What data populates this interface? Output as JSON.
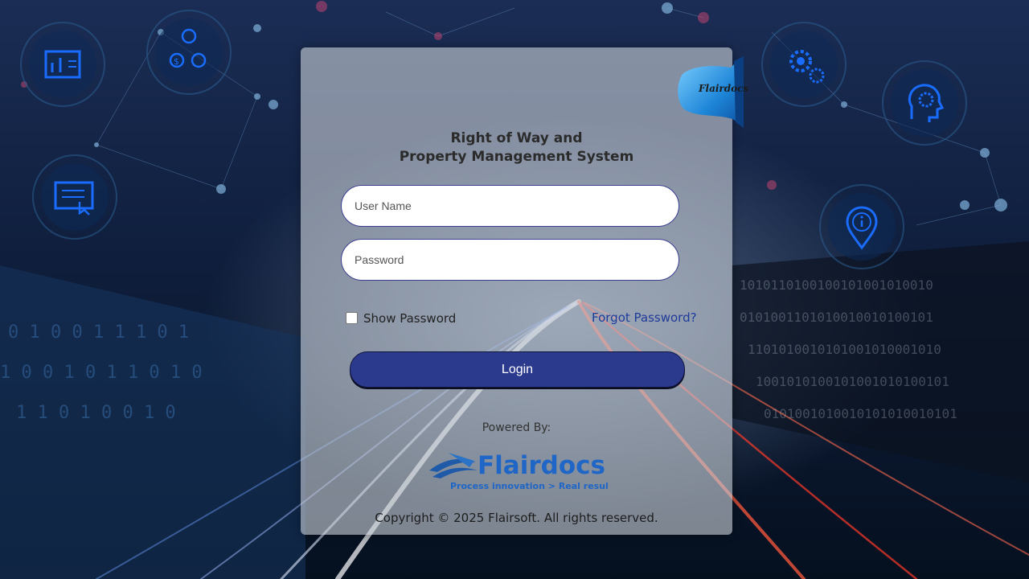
{
  "title_lines": [
    "Right of Way and",
    "Property Management System"
  ],
  "inputs": {
    "username_placeholder": "User Name",
    "password_placeholder": "Password"
  },
  "show_password_label": "Show Password",
  "forgot_password_label": "Forgot Password?",
  "login_label": "Login",
  "powered_by": "Powered By:",
  "brand": {
    "name": "Flairdocs",
    "tagline": "Process innovation > Real results.",
    "ribbon_text": "Flairdocs"
  },
  "copyright": "Copyright © 2025 Flairsoft. All rights reserved.",
  "background_icons": [
    "dashboard-icon",
    "finance-people-icon",
    "checklist-touch-icon",
    "gears-icon",
    "ai-brain-gear-icon",
    "info-location-icon"
  ],
  "colors": {
    "accent": "#2c3a8e",
    "link": "#1f3b9a",
    "icon": "#1a6cff"
  }
}
